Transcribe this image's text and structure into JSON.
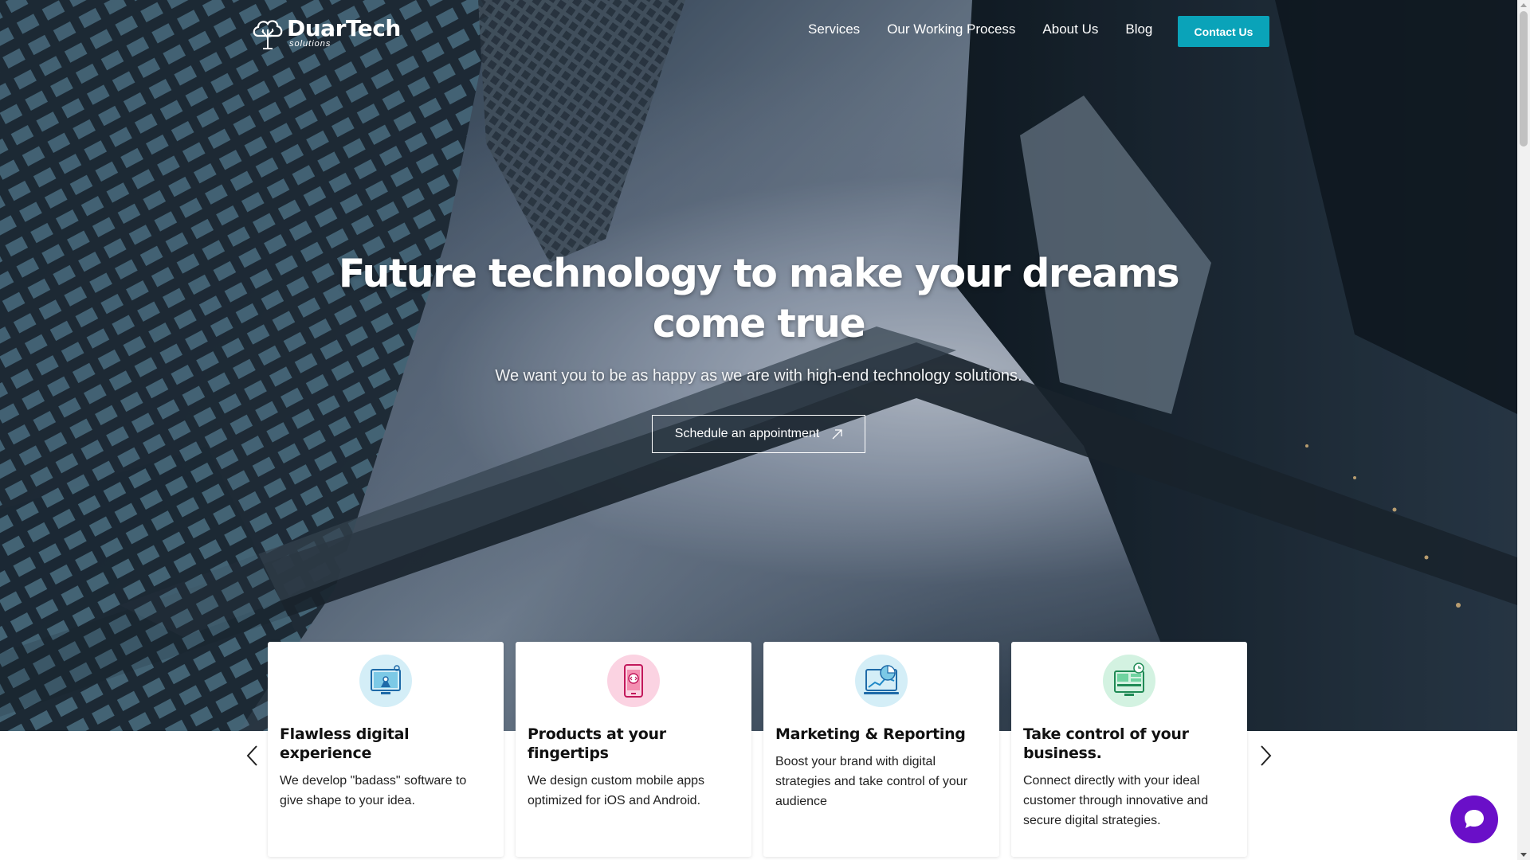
{
  "nav": {
    "logo_name": "DuarTech",
    "logo_sub": "solutions",
    "links": [
      "Services",
      "Our Working Process",
      "About Us",
      "Blog"
    ],
    "contact_label": "Contact Us"
  },
  "hero": {
    "title": "Future technology to make your dreams come true",
    "subtitle": "We want you to be as happy as we are with high-end technology solutions.",
    "cta_label": "Schedule an appointment",
    "cta_icon": "arrow-up-right-icon"
  },
  "cards": [
    {
      "icon": "web-design-icon",
      "title": "Flawless digital experience",
      "text": "We develop \"badass\" software to give shape to your idea."
    },
    {
      "icon": "mobile-code-icon",
      "title": "Products at your fingertips",
      "text": "We design custom mobile apps optimized for iOS and Android."
    },
    {
      "icon": "analytics-icon",
      "title": "Marketing & Reporting",
      "text": "Boost your brand with digital strategies and take control of your audience"
    },
    {
      "icon": "dashboard-icon",
      "title": "Take control of your business.",
      "text": "Connect directly with your ideal customer through innovative and secure digital strategies."
    }
  ],
  "carousel": {
    "prev_icon": "chevron-left-icon",
    "next_icon": "chevron-right-icon"
  },
  "chat": {
    "icon": "chat-bubble-icon"
  },
  "colors": {
    "accent": "#0aa3b9",
    "chat": "#6a0fc8",
    "icon_blue": "#1e88c7",
    "icon_pink": "#e91e63",
    "icon_green": "#2aa86a"
  }
}
